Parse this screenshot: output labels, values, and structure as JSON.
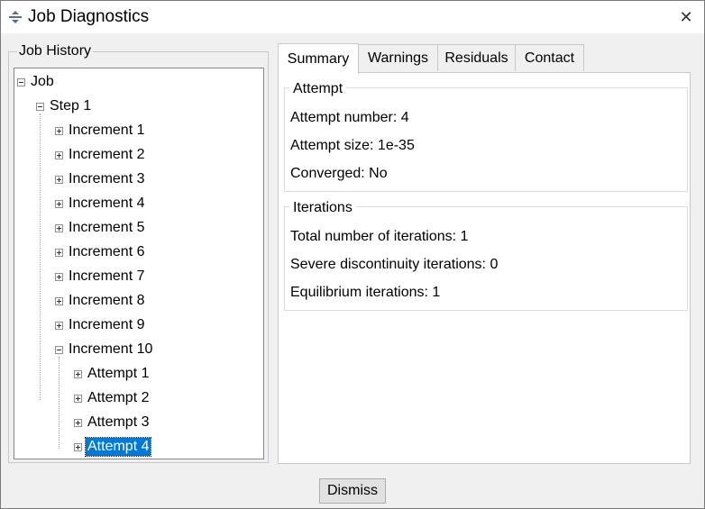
{
  "window": {
    "title": "Job Diagnostics"
  },
  "history": {
    "legend": "Job History",
    "root": "Job",
    "step": "Step 1",
    "increments": [
      "Increment 1",
      "Increment 2",
      "Increment 3",
      "Increment 4",
      "Increment 5",
      "Increment 6",
      "Increment 7",
      "Increment 8",
      "Increment 9",
      "Increment 10"
    ],
    "attempts": [
      "Attempt 1",
      "Attempt 2",
      "Attempt 3",
      "Attempt 4"
    ],
    "selected": "Attempt 4"
  },
  "tabs": [
    "Summary",
    "Warnings",
    "Residuals",
    "Contact"
  ],
  "active_tab": "Summary",
  "summary": {
    "attempt": {
      "legend": "Attempt",
      "number": "Attempt number: 4",
      "size": "Attempt size: 1e-35",
      "converged": "Converged: No"
    },
    "iterations": {
      "legend": "Iterations",
      "total": "Total number of iterations: 1",
      "severe": "Severe discontinuity iterations: 0",
      "equilibrium": "Equilibrium iterations: 1"
    }
  },
  "buttons": {
    "dismiss": "Dismiss"
  }
}
